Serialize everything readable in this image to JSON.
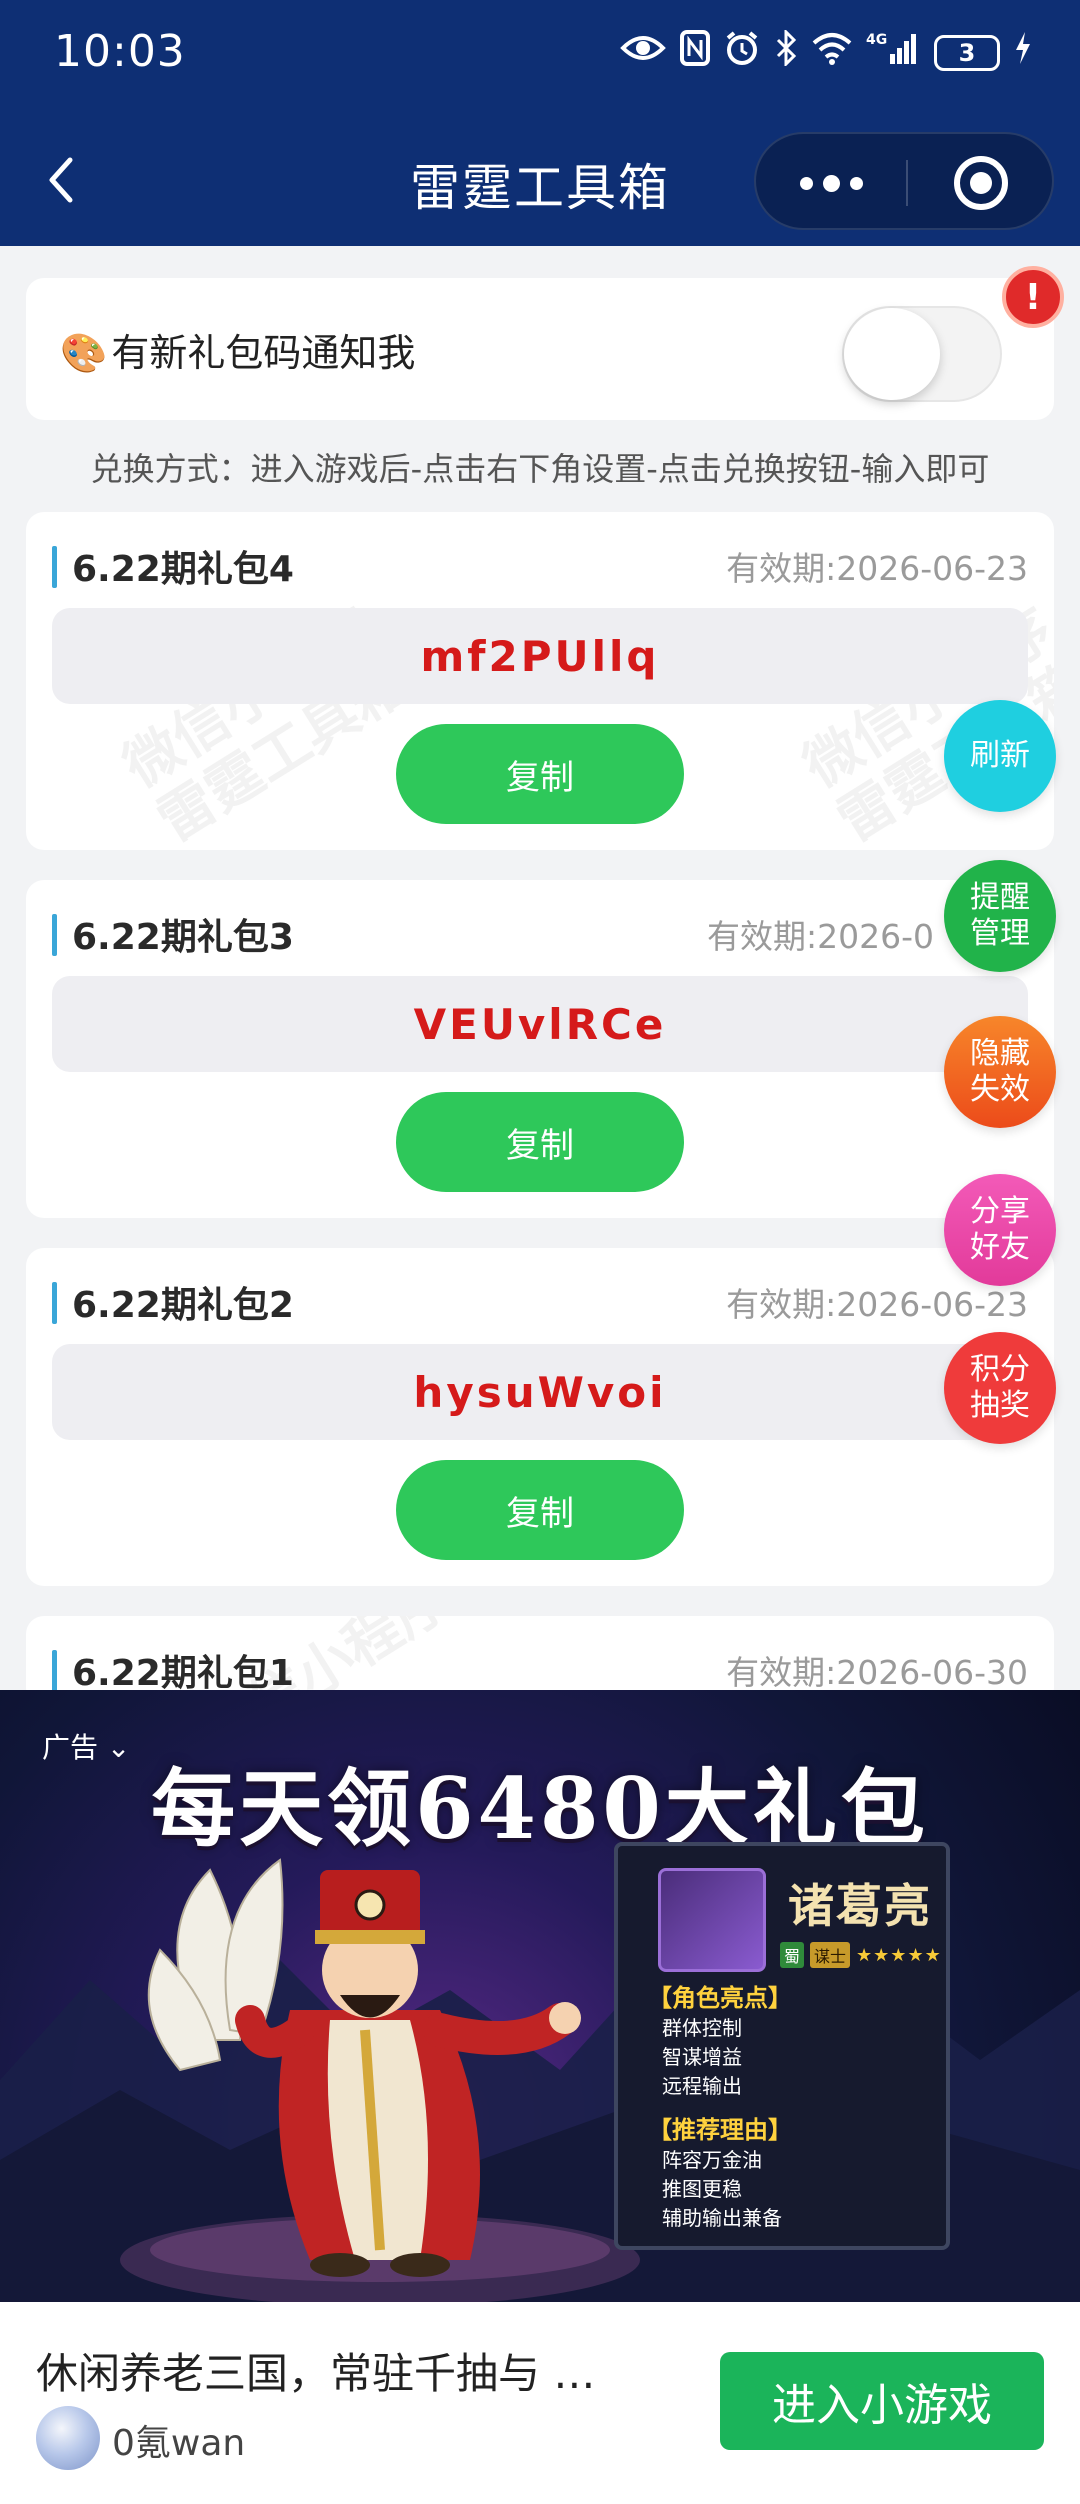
{
  "status_bar": {
    "time": "10:03",
    "battery": "3",
    "network": "4G"
  },
  "nav": {
    "title": "雷霆工具箱"
  },
  "notify": {
    "label": "有新礼包码通知我",
    "toggle_on": false,
    "alert_badge": "!"
  },
  "howto": "兑换方式：进入游戏后-点击右下角设置-点击兑换按钮-输入即可",
  "gifts": [
    {
      "title": "6.22期礼包4",
      "expiry": "有效期:2026-06-23",
      "code": "mf2PUllq",
      "copy_label": "复制"
    },
    {
      "title": "6.22期礼包3",
      "expiry": "有效期:2026-0",
      "code": "VEUvlRCe",
      "copy_label": "复制"
    },
    {
      "title": "6.22期礼包2",
      "expiry": "有效期:2026-06-23",
      "code": "hysuWvoi",
      "copy_label": "复制"
    },
    {
      "title": "6.22期礼包1",
      "expiry": "有效期:2026-06-30"
    }
  ],
  "watermark": {
    "line1": "微信小程序",
    "line2": "雷霆工具箱"
  },
  "fabs": [
    {
      "label": "刷新",
      "color": "#1fcfe0"
    },
    {
      "label": "提醒管理",
      "color": "#21b34a"
    },
    {
      "label": "隐藏失效",
      "color": "#f0621c"
    },
    {
      "label": "分享好友",
      "color": "#ee4bb0"
    },
    {
      "label": "积分抽奖",
      "color": "#ef3b3b"
    }
  ],
  "ad": {
    "label": "广告",
    "headline": "每天领6480大礼包",
    "hero_name": "诸葛亮",
    "hero_faction": "蜀",
    "hero_role": "谋士",
    "hero_stars": "★★★★★",
    "section1_title": "【角色亮点】",
    "section1_items": [
      "群体控制",
      "智谋增益",
      "远程输出"
    ],
    "section2_title": "【推荐理由】",
    "section2_items": [
      "阵容万金油",
      "推图更稳",
      "辅助输出兼备"
    ]
  },
  "bottom": {
    "title": "休闲养老三国，常驻千抽与 …",
    "author": "0氪wan",
    "cta": "进入小游戏"
  },
  "colors": {
    "header_bg": "#0e2f74",
    "code_red": "#d51a1a",
    "copy_green": "#2ec85a",
    "cta_green": "#1bb45a"
  }
}
